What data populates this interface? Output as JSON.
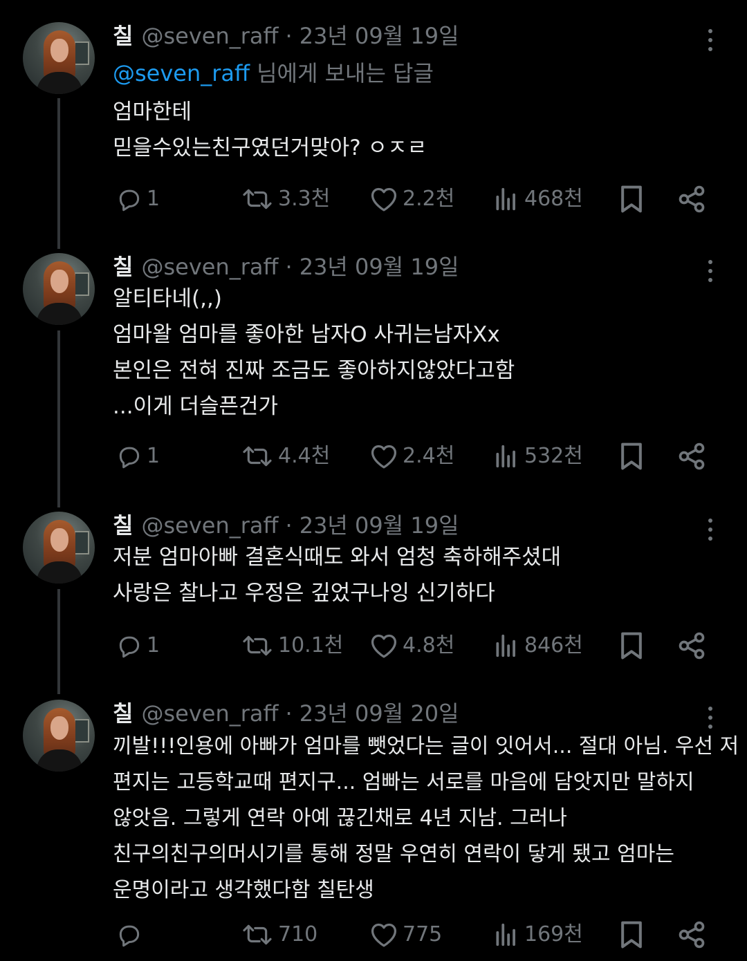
{
  "colors": {
    "background": "#000000",
    "text": "#e7e9ea",
    "muted": "#71767b",
    "link": "#1d9bf0",
    "thread_line": "#333639"
  },
  "tweets": [
    {
      "name": "칠",
      "handle": "@seven_raff",
      "dot": "·",
      "date": "23년 09월 19일",
      "reply_mention": "@seven_raff",
      "reply_suffix": "님에게 보내는 답글",
      "lines": [
        "엄마한테",
        "믿을수있는친구였던거맞아? ㅇㅈㄹ"
      ],
      "replies": "1",
      "retweets": "3.3천",
      "likes": "2.2천",
      "views": "468천"
    },
    {
      "name": "칠",
      "handle": "@seven_raff",
      "dot": "·",
      "date": "23년 09월 19일",
      "lines": [
        "알티타네(,,)",
        "엄마왈 엄마를 좋아한 남자O 사귀는남자Xx",
        "본인은 전혀 진짜 조금도 좋아하지않았다고함",
        "...이게 더슬픈건가"
      ],
      "replies": "1",
      "retweets": "4.4천",
      "likes": "2.4천",
      "views": "532천"
    },
    {
      "name": "칠",
      "handle": "@seven_raff",
      "dot": "·",
      "date": "23년 09월 19일",
      "lines": [
        "저분 엄마아빠 결혼식때도 와서 엄청 축하해주셨대",
        "사랑은 찰나고 우정은 깊었구나잉 신기하다"
      ],
      "replies": "1",
      "retweets": "10.1천",
      "likes": "4.8천",
      "views": "846천"
    },
    {
      "name": "칠",
      "handle": "@seven_raff",
      "dot": "·",
      "date": "23년 09월 20일",
      "lines": [
        "끼발!!!인용에 아빠가 엄마를 뺏었다는 글이 잇어서... 절대 아님. 우선 저",
        "편지는 고등학교때 편지구... 엄빠는 서로를 마음에 담앗지만 말하지",
        "않앗음. 그렇게 연락 아예 끊긴채로 4년 지남. 그러나",
        "친구의친구의머시기를 통해 정말 우연히 연락이 닿게 됐고 엄마는",
        "운명이라고 생각했다함 칠탄생"
      ],
      "replies": "",
      "retweets": "710",
      "likes": "775",
      "views": "169천"
    }
  ]
}
